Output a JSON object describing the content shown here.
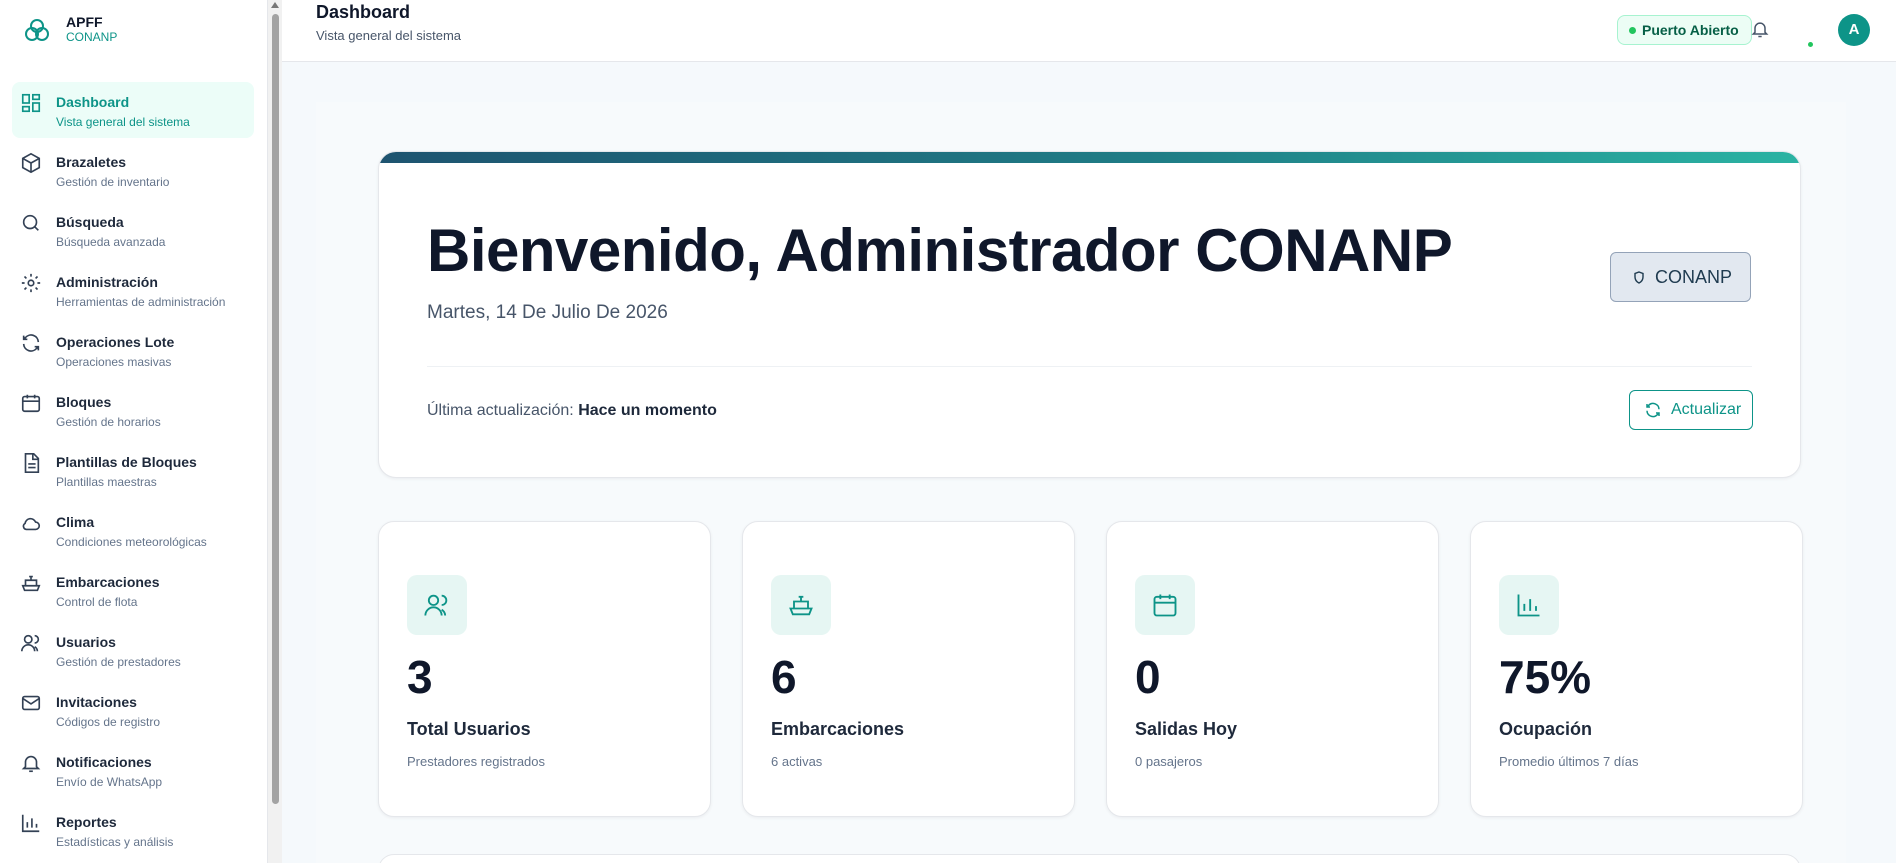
{
  "brand": {
    "name": "APFF",
    "org": "CONANP"
  },
  "sidebar": {
    "items": [
      {
        "label": "Dashboard",
        "sub": "Vista general del sistema",
        "icon": "dashboard-icon",
        "active": true
      },
      {
        "label": "Brazaletes",
        "sub": "Gestión de inventario",
        "icon": "package-icon"
      },
      {
        "label": "Búsqueda",
        "sub": "Búsqueda avanzada",
        "icon": "search-icon"
      },
      {
        "label": "Administración",
        "sub": "Herramientas de administración",
        "icon": "gear-icon"
      },
      {
        "label": "Operaciones Lote",
        "sub": "Operaciones masivas",
        "icon": "refresh-icon"
      },
      {
        "label": "Bloques",
        "sub": "Gestión de horarios",
        "icon": "calendar-icon"
      },
      {
        "label": "Plantillas de Bloques",
        "sub": "Plantillas maestras",
        "icon": "document-icon"
      },
      {
        "label": "Clima",
        "sub": "Condiciones meteorológicas",
        "icon": "cloud-icon"
      },
      {
        "label": "Embarcaciones",
        "sub": "Control de flota",
        "icon": "ship-icon"
      },
      {
        "label": "Usuarios",
        "sub": "Gestión de prestadores",
        "icon": "users-icon"
      },
      {
        "label": "Invitaciones",
        "sub": "Códigos de registro",
        "icon": "mail-icon"
      },
      {
        "label": "Notificaciones",
        "sub": "Envío de WhatsApp",
        "icon": "bell-icon"
      },
      {
        "label": "Reportes",
        "sub": "Estadísticas y análisis",
        "icon": "bar-chart-icon"
      }
    ]
  },
  "header": {
    "title": "Dashboard",
    "subtitle": "Vista general del sistema",
    "status": "Puerto Abierto",
    "status_color": "#22c55e",
    "avatar_initial": "A"
  },
  "hero": {
    "title": "Bienvenido, Administrador CONANP",
    "date": "Martes, 14 De Julio De 2026",
    "badge": "CONANP",
    "updated_label": "Última actualización:",
    "updated_value": "Hace un momento",
    "refresh_label": "Actualizar"
  },
  "stats": [
    {
      "value": "3",
      "label": "Total Usuarios",
      "sub": "Prestadores registrados",
      "icon": "users-icon"
    },
    {
      "value": "6",
      "label": "Embarcaciones",
      "sub": "6 activas",
      "icon": "ship-icon"
    },
    {
      "value": "0",
      "label": "Salidas Hoy",
      "sub": "0 pasajeros",
      "icon": "calendar-icon"
    },
    {
      "value": "75%",
      "label": "Ocupación",
      "sub": "Promedio últimos 7 días",
      "icon": "bar-chart-icon"
    }
  ],
  "colors": {
    "accent": "#0d9488",
    "text": "#0f172a",
    "muted": "#64748b"
  }
}
